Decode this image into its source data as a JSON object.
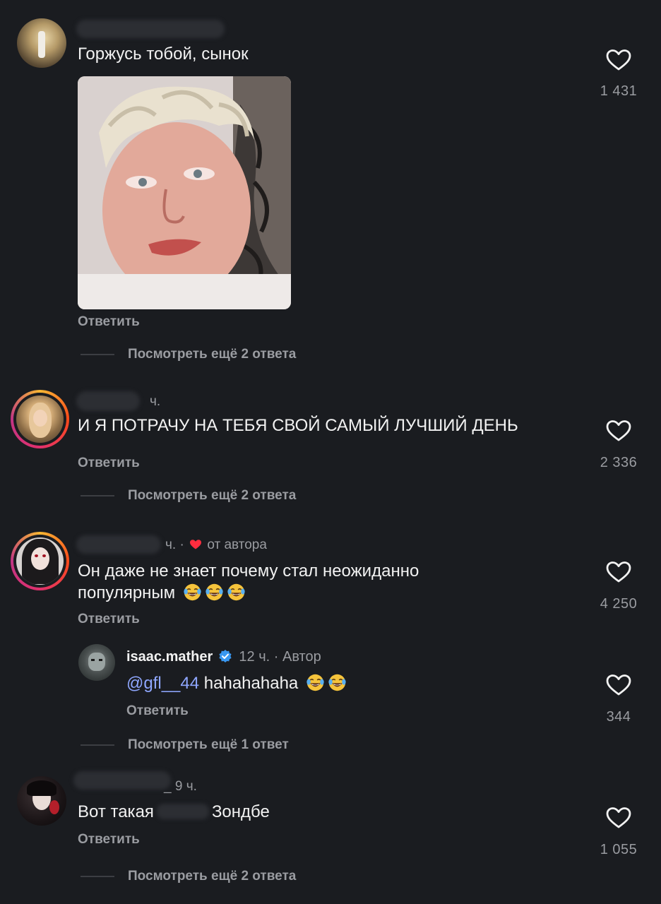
{
  "comments": [
    {
      "text": "Горжусь тобой, сынок",
      "reply_label": "Ответить",
      "likes": "1 431",
      "view_more": "Посмотреть ещё 2 ответа"
    },
    {
      "meta": "ч.",
      "text": "И Я ПОТРАЧУ НА ТЕБЯ СВОЙ САМЫЙ ЛУЧШИЙ ДЕНЬ",
      "reply_label": "Ответить",
      "likes": "2 336",
      "view_more": "Посмотреть ещё 2 ответа"
    },
    {
      "meta_time": "ч. ·",
      "author_liked": "от автора",
      "text_line1": "Он даже не знает почему стал неожиданно",
      "text_line2": "популярным",
      "reply_label": "Ответить",
      "likes": "4 250",
      "reply": {
        "username": "isaac.mather",
        "time": "12 ч.",
        "author_tag": "· Автор",
        "mention": "@gfl__44",
        "text": "hahahahaha",
        "reply_label": "Ответить",
        "likes": "344"
      },
      "view_more": "Посмотреть ещё 1 ответ"
    },
    {
      "meta": "_ 9 ч.",
      "text_start": "Вот такая",
      "text_end": "Зондбе",
      "reply_label": "Ответить",
      "likes": "1 055",
      "view_more": "Посмотреть ещё 2 ответа"
    }
  ],
  "icons": {
    "like": "heart-outline-icon",
    "verified": "verified-badge-icon",
    "emoji": "face-with-tears-of-joy-emoji"
  },
  "colors": {
    "background": "#1a1c20",
    "text_primary": "#f2f2f2",
    "text_secondary": "#9a9ca1",
    "mention": "#8fa7ff",
    "verified": "#3897f0",
    "author_heart": "#ff2d3f"
  }
}
